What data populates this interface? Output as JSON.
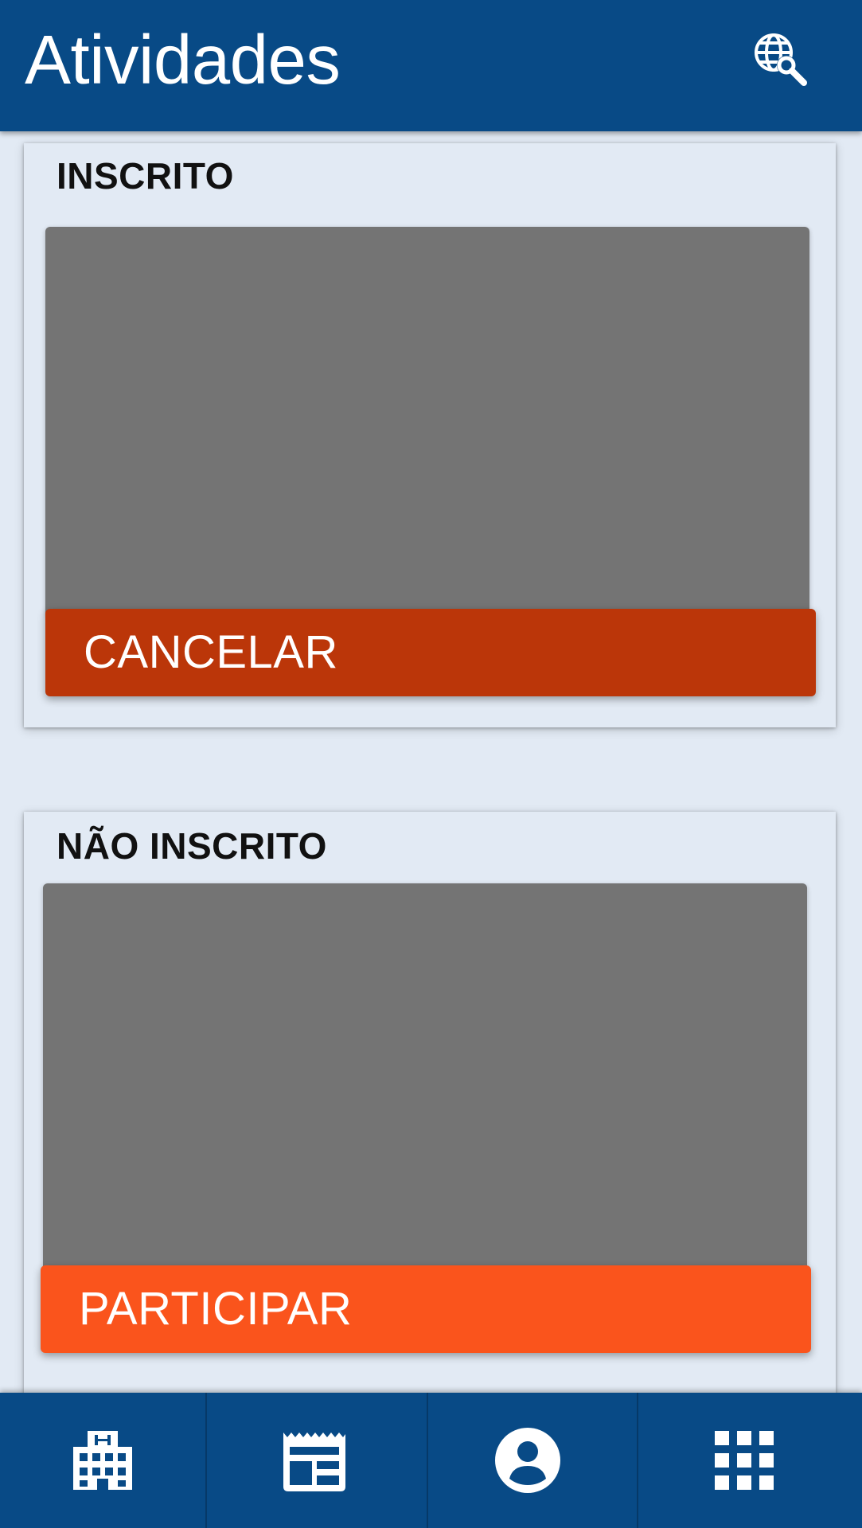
{
  "header": {
    "title": "Atividades",
    "search_icon": "travel-explore-icon"
  },
  "cards": [
    {
      "heading": "INSCRITO",
      "button_label": "CANCELAR",
      "button_color": "#bb3609"
    },
    {
      "heading": "NÃO INSCRITO",
      "button_label": "PARTICIPAR",
      "button_color": "#fa541c"
    }
  ],
  "bottom_nav": {
    "items": [
      {
        "icon": "hospital-icon"
      },
      {
        "icon": "newspaper-icon"
      },
      {
        "icon": "account-circle-icon"
      },
      {
        "icon": "apps-grid-icon"
      }
    ]
  },
  "colors": {
    "primary": "#084a86",
    "background": "#e2eaf4",
    "placeholder": "#747474"
  }
}
